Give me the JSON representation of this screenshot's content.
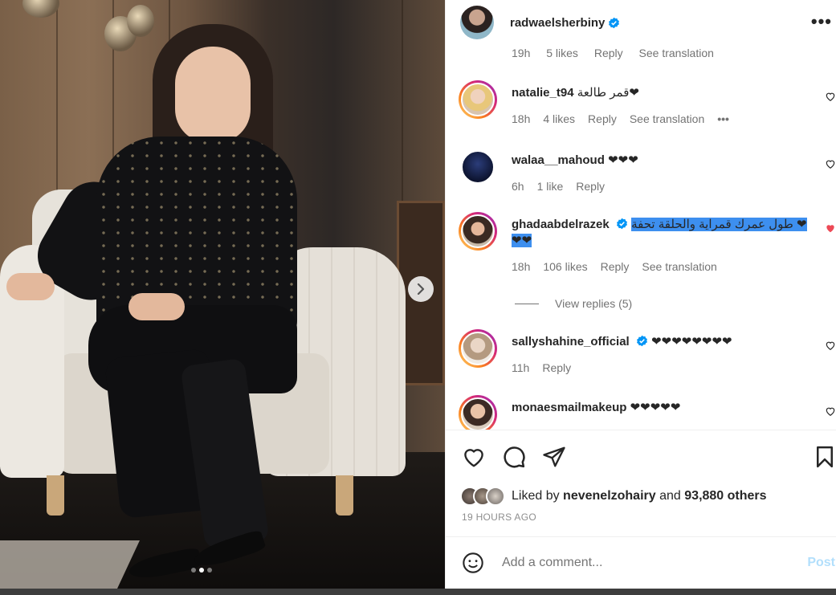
{
  "post": {
    "username": "radwaelsherbiny",
    "verified": true,
    "more_icon": "more-horizontal-icon",
    "image_dots": 3,
    "active_dot": 1
  },
  "partial_comment": {
    "time": "19h",
    "likes": "5 likes",
    "reply": "Reply",
    "translate": "See translation"
  },
  "comments": [
    {
      "username": "natalie_t94",
      "verified": false,
      "text": "قمر طالعة❤",
      "time": "18h",
      "likes": "4 likes",
      "reply": "Reply",
      "translate": "See translation",
      "options": "•••",
      "liked": false
    },
    {
      "username": "walaa__mahoud",
      "verified": false,
      "text": "❤❤❤",
      "time": "6h",
      "likes": "1 like",
      "reply": "Reply",
      "liked": false
    },
    {
      "username": "ghadaabdelrazek",
      "verified": true,
      "text": "طول عمرك قمراية والحلقة تحفة ❤ ❤❤",
      "time": "18h",
      "likes": "106 likes",
      "reply": "Reply",
      "translate": "See translation",
      "liked": true
    },
    {
      "username": "sallyshahine_official",
      "verified": true,
      "text": "❤❤❤❤❤❤❤❤",
      "time": "11h",
      "reply": "Reply",
      "liked": false
    },
    {
      "username": "monaesmailmakeup",
      "verified": false,
      "text": "❤❤❤❤❤",
      "liked": false
    }
  ],
  "view_replies": "View replies (5)",
  "likes_summary": {
    "prefix": "Liked by",
    "user": "nevenelzohairy",
    "middle": "and",
    "others": "93,880 others"
  },
  "timestamp": "19 HOURS AGO",
  "add_comment": {
    "placeholder": "Add a comment...",
    "post_label": "Post"
  },
  "colors": {
    "like_red": "#ed4956",
    "verified_blue": "#0095f6",
    "highlight": "#3d8fef"
  }
}
